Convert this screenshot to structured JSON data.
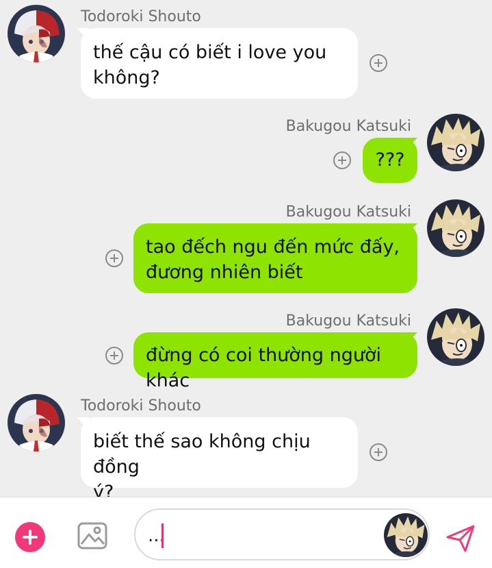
{
  "messages": [
    {
      "sender": "Todoroki Shouto",
      "side": "left",
      "lines": [
        "thế cậu có biết i love you",
        "không?"
      ]
    },
    {
      "sender": "Bakugou Katsuki",
      "side": "right",
      "lines": [
        "???"
      ]
    },
    {
      "sender": "Bakugou Katsuki",
      "side": "right",
      "lines": [
        "tao đếch ngu đến mức đấy,",
        "đương nhiên biết"
      ]
    },
    {
      "sender": "Bakugou Katsuki",
      "side": "right",
      "lines": [
        "đừng có coi thường người khác"
      ]
    },
    {
      "sender": "Todoroki Shouto",
      "side": "left",
      "lines": [
        "biết thế sao không chịu đồng",
        "ý?"
      ]
    }
  ],
  "composer": {
    "input_value": "..."
  },
  "icons": {
    "add": "plus-circle-icon",
    "gallery": "image-icon",
    "send": "paper-plane-icon",
    "reaction": "add-reaction-icon"
  },
  "colors": {
    "my_bubble": "#8ee400",
    "their_bubble": "#ffffff",
    "accent": "#f2377a",
    "background": "#eeeeee"
  }
}
